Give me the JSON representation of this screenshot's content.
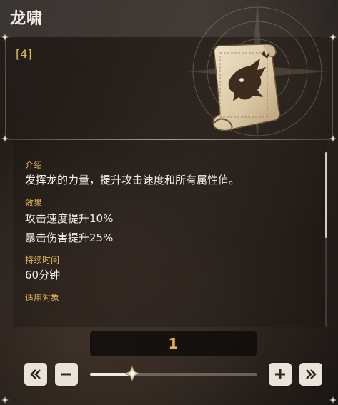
{
  "item": {
    "name": "龙啸",
    "level_tag": "[4]"
  },
  "sections": {
    "intro_label": "介绍",
    "intro_text": "发挥龙的力量，提升攻击速度和所有属性值。",
    "effect_label": "效果",
    "effect_lines": [
      "攻击速度提升10%",
      "暴击伤害提升25%"
    ],
    "duration_label": "持续时间",
    "duration_value": "60分钟",
    "target_label": "适用对象"
  },
  "quantity": {
    "value": "1",
    "slider_fraction": 0.25
  },
  "icons": {
    "min": "double-chevron-left-icon",
    "decrease": "minus-icon",
    "increase": "plus-icon",
    "max": "double-chevron-right-icon",
    "item": "dragon-scroll-icon"
  },
  "colors": {
    "accent_gold": "#e6b14c",
    "label_gold": "#e3b55a",
    "button_bg": "#e9e3da"
  }
}
